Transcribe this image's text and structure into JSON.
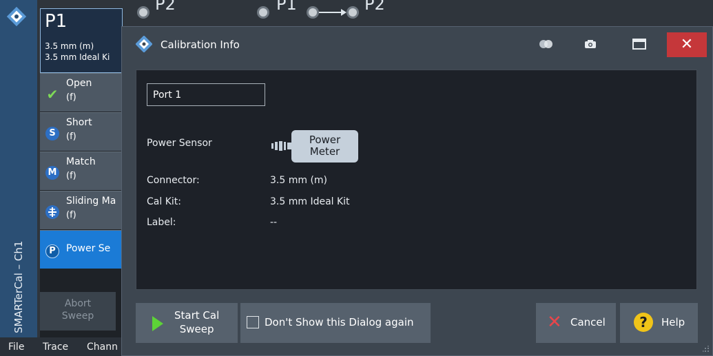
{
  "background": {
    "vertical_label": "SMARTerCal – Ch1",
    "port_box": {
      "port": "P1",
      "connector": "3.5 mm (m)",
      "kit": "3.5 mm Ideal Ki"
    },
    "top_ports": {
      "p2": "P2",
      "pair_p1": "P1",
      "pair_p2": "P2"
    },
    "standards": [
      {
        "name": "Open",
        "sub": "(f)",
        "icon": "check-icon",
        "status": "done"
      },
      {
        "name": "Short",
        "sub": "(f)",
        "icon": "S"
      },
      {
        "name": "Match",
        "sub": "(f)",
        "icon": "M"
      },
      {
        "name": "Sliding Ma",
        "sub": "(f)",
        "icon": "sliding-match-icon"
      },
      {
        "name": "Power Se",
        "sub": "",
        "icon": "P",
        "active": true
      }
    ],
    "abort_button": {
      "line1": "Abort",
      "line2": "Sweep"
    },
    "menu": [
      "File",
      "Trace",
      "Chann"
    ]
  },
  "dialog": {
    "title": "Calibration Info",
    "port_field": "Port 1",
    "power_sensor_label": "Power Sensor",
    "power_meter_line1": "Power",
    "power_meter_line2": "Meter",
    "rows": [
      {
        "label": "Connector:",
        "value": "3.5 mm (m)"
      },
      {
        "label": "Cal Kit:",
        "value": "3.5 mm Ideal Kit"
      },
      {
        "label": "Label:",
        "value": "--"
      }
    ],
    "start_button": {
      "line1": "Start Cal",
      "line2": "Sweep"
    },
    "dont_show_label": "Don't Show this Dialog again",
    "dont_show_checked": false,
    "cancel_label": "Cancel",
    "help_label": "Help"
  },
  "colors": {
    "accent": "#1b7bd6",
    "close": "#c5373a",
    "play": "#5dd337",
    "cancel_x": "#e8464b",
    "help": "#f0c419"
  }
}
